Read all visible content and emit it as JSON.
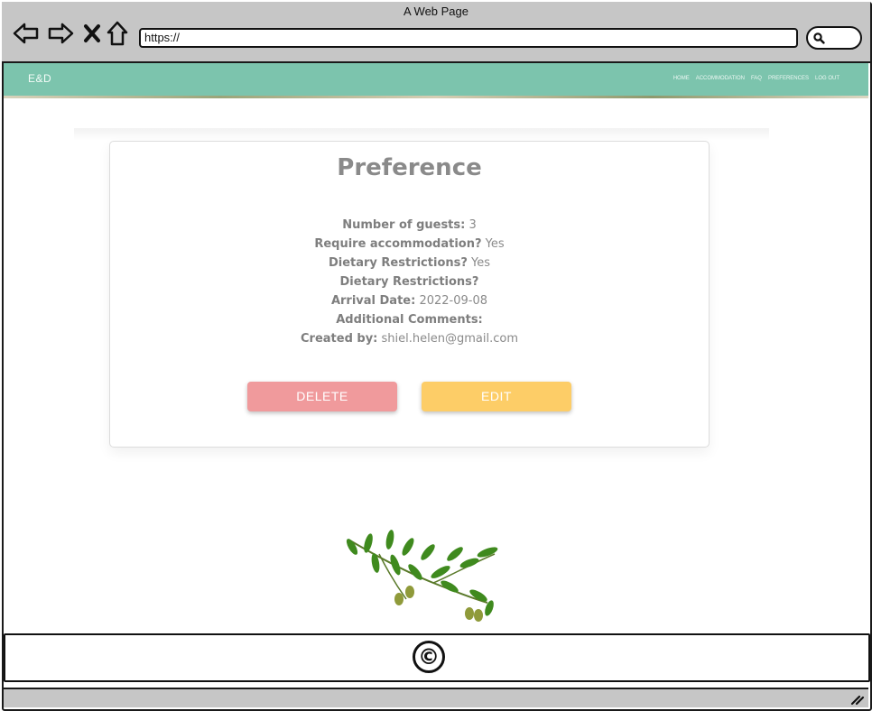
{
  "window": {
    "title": "A Web Page",
    "url": "https://"
  },
  "icons": {
    "back": "arrow-left-icon",
    "forward": "arrow-right-icon",
    "stop": "close-icon",
    "home": "home-icon",
    "search": "search-icon",
    "copyright": "copyright-icon",
    "resize": "resize-grip-icon",
    "decoration": "olive-branch-image"
  },
  "navbar": {
    "brand": "E&D",
    "links": [
      "HOME",
      "ACCOMMODATION",
      "FAQ",
      "PREFERENCES",
      "LOG OUT"
    ]
  },
  "preference": {
    "title": "Preference",
    "fields": [
      {
        "label": "Number of guests:",
        "value": "3"
      },
      {
        "label": "Require accommodation?",
        "value": "Yes"
      },
      {
        "label": "Dietary Restrictions?",
        "value": "Yes"
      },
      {
        "label": "Dietary Restrictions?",
        "value": ""
      },
      {
        "label": "Arrival Date:",
        "value": "2022-09-08"
      },
      {
        "label": "Additional Comments:",
        "value": ""
      },
      {
        "label": "Created by:",
        "value": "shiel.helen@gmail.com"
      }
    ],
    "buttons": {
      "delete": "DELETE",
      "edit": "EDIT"
    }
  },
  "footer": {
    "copyright_symbol": "©"
  },
  "colors": {
    "navbar": "#7cc4ad",
    "delete": "#f09a9c",
    "edit": "#fdcd67",
    "text": "#8a8a8a"
  }
}
